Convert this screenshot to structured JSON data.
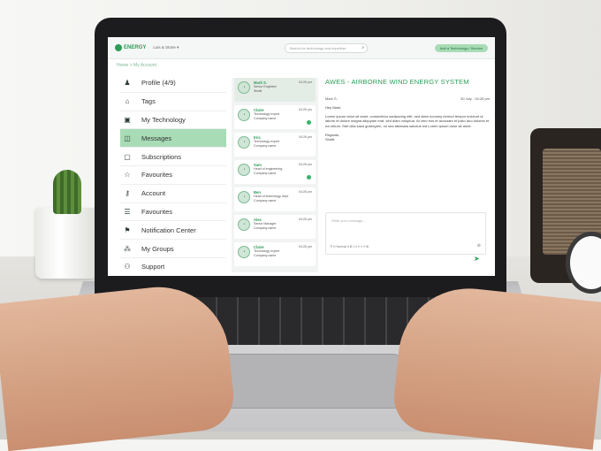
{
  "topbar": {
    "logo": "ENERGY",
    "user_menu": "Luis & Stone ▾",
    "search_placeholder": "Search for technology and expertise",
    "cta": "Add a Technology / Service"
  },
  "breadcrumb": "Home > My Account",
  "sidebar": {
    "items": [
      {
        "label": "Profile (4/9)",
        "icon": "person-icon"
      },
      {
        "label": "Tags",
        "icon": "tag-icon"
      },
      {
        "label": "My Technology",
        "icon": "briefcase-icon"
      },
      {
        "label": "Messages",
        "icon": "messages-icon"
      },
      {
        "label": "Subscriptions",
        "icon": "subscription-icon"
      },
      {
        "label": "Favourites",
        "icon": "star-icon"
      },
      {
        "label": "Account",
        "icon": "key-icon"
      },
      {
        "label": "Favourites",
        "icon": "list-icon"
      },
      {
        "label": "Notification Center",
        "icon": "notification-icon"
      },
      {
        "label": "My Groups",
        "icon": "groups-icon"
      },
      {
        "label": "Support",
        "icon": "support-icon"
      }
    ],
    "active_index": 3
  },
  "conversations": [
    {
      "name": "Mark S.",
      "role": "Senior Engineer",
      "company": "Shuttt",
      "time": "04:26 pm",
      "unread": false
    },
    {
      "name": "Claire",
      "role": "Technology expert",
      "company": "Company name",
      "time": "04:26 pm",
      "unread": true
    },
    {
      "name": "Eric",
      "role": "Technology expert",
      "company": "Company name",
      "time": "04:26 pm",
      "unread": false
    },
    {
      "name": "Sam",
      "role": "Head of engineering",
      "company": "Company name",
      "time": "04:26 pm",
      "unread": true
    },
    {
      "name": "Ben",
      "role": "Head of technology dept.",
      "company": "Company name",
      "time": "04:26 pm",
      "unread": false
    },
    {
      "name": "Alex",
      "role": "Senior Manager",
      "company": "Company name",
      "time": "04:26 pm",
      "unread": false
    },
    {
      "name": "Claire",
      "role": "Technology expert",
      "company": "Company name",
      "time": "04:26 pm",
      "unread": false
    }
  ],
  "message": {
    "title": "AWES - AIRBORNE WIND ENERGY SYSTEM",
    "from": "Mark S.",
    "date": "30 July · 04:26 pm",
    "greeting": "Hey Mark,",
    "body": "Lorem ipsum dolor sit amet, consectetur sadipscing elitr, sed diam nonumy eirmod tempor invidunt ut labore et dolore magna aliquyam erat, sed diam voluptua. At vero eos et accusam et justo duo dolores et ea rebum. Stet clita kasd gubergren, no sea takimata sanctus est Lorem ipsum dolor sit amet.",
    "signoff": "Regards,",
    "signature": "Shuttt",
    "compose_placeholder": "Write your message...",
    "toolbar": "¶  H  Normal ▾  B  I  U  ≡  ≡  ≡  ⊞",
    "attach": "⊘",
    "send": "➤"
  }
}
